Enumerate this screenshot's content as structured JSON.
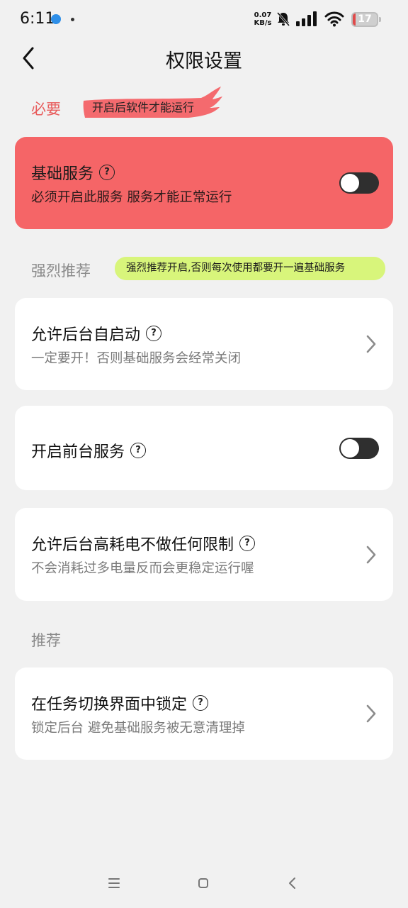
{
  "status_bar": {
    "time": "6:11",
    "net_speed_value": "0.07",
    "net_speed_unit": "KB/s",
    "battery": "17",
    "icons": [
      "location-icon",
      "mute-icon",
      "signal-icon",
      "wifi-icon",
      "battery-icon"
    ]
  },
  "header": {
    "title": "权限设置",
    "back_icon": "chevron-left-icon"
  },
  "sections": {
    "required": {
      "label": "必要",
      "tag": "开启后软件才能运行"
    },
    "strongly_recommended": {
      "label": "强烈推荐",
      "tag": "强烈推荐开启,否则每次使用都要开一遍基础服务"
    },
    "recommended": {
      "label": "推荐"
    }
  },
  "cards": {
    "basic_service": {
      "title": "基础服务",
      "subtitle": "必须开启此服务 服务才能正常运行",
      "toggle_on": false
    },
    "autostart": {
      "title": "允许后台自启动",
      "subtitle": "一定要开！否则基础服务会经常关闭"
    },
    "foreground_service": {
      "title": "开启前台服务",
      "toggle_on": false
    },
    "battery": {
      "title": "允许后台高耗电不做任何限制",
      "subtitle": "不会消耗过多电量反而会更稳定运行喔"
    },
    "lock_task": {
      "title": "在任务切换界面中锁定",
      "subtitle": "锁定后台 避免基础服务被无意清理掉"
    }
  },
  "nav_bar": {
    "buttons": [
      "menu-icon",
      "home-icon",
      "back-icon"
    ]
  },
  "colors": {
    "background": "#f1f1f1",
    "required_accent": "#e85c5c",
    "required_card": "#f56567",
    "strong_tag": "#d8f57b",
    "toggle_off": "#2f2f2f"
  }
}
